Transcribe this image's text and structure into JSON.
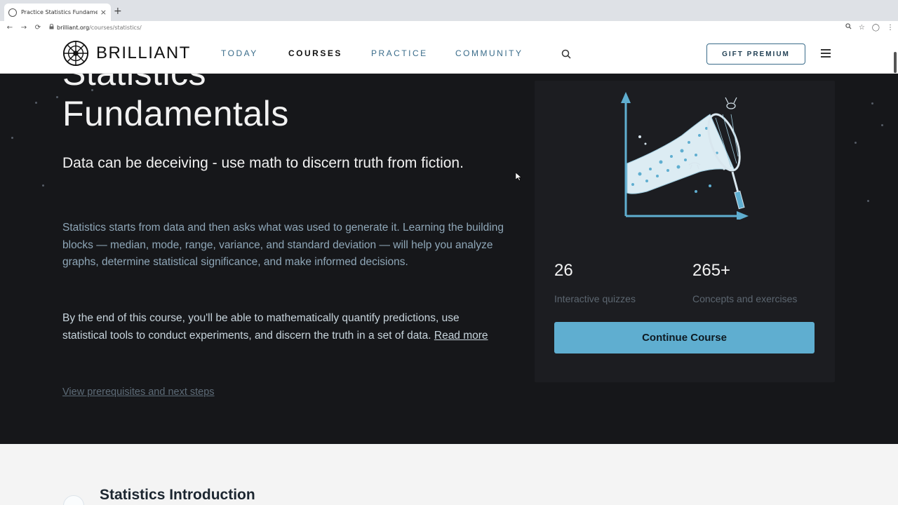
{
  "browser": {
    "tab_title": "Practice Statistics Fundamenta",
    "tab_close": "×",
    "new_tab": "+",
    "url_host": "brilliant.org",
    "url_path": "/courses/statistics/",
    "back": "←",
    "forward": "→",
    "reload": "⟳",
    "lock": "🔒",
    "zoom_icon": "🔍",
    "star_icon": "☆",
    "ext_icon": "◯",
    "more_icon": "⋮"
  },
  "header": {
    "logo_text": "BRILLIANT",
    "nav": [
      {
        "label": "TODAY"
      },
      {
        "label": "COURSES"
      },
      {
        "label": "PRACTICE"
      },
      {
        "label": "COMMUNITY"
      }
    ],
    "gift_label": "GIFT PREMIUM"
  },
  "hero": {
    "title_line1": "Statistics",
    "title_line2": "Fundamentals",
    "tagline": "Data can be deceiving - use math to discern truth from fiction.",
    "desc1": "Statistics starts from data and then asks what was used to generate it. Learning the building blocks — median, mode, range, variance, and standard deviation — will help you analyze graphs, determine statistical significance, and make informed decisions.",
    "desc2": "By the end of this course, you'll be able to mathematically quantify predictions, use statistical tools to conduct experiments, and discern the truth in a set of data.",
    "read_more": "Read more",
    "prereq_link": "View prerequisites and next steps"
  },
  "card": {
    "quizzes_count": "26",
    "quizzes_label": "Interactive quizzes",
    "concepts_count": "265+",
    "concepts_label": "Concepts and exercises",
    "continue_label": "Continue Course"
  },
  "next_section": {
    "title": "Statistics Introduction"
  },
  "colors": {
    "hero_bg": "#16171a",
    "accent": "#5faed0",
    "nav_link": "#3a6c8a"
  }
}
